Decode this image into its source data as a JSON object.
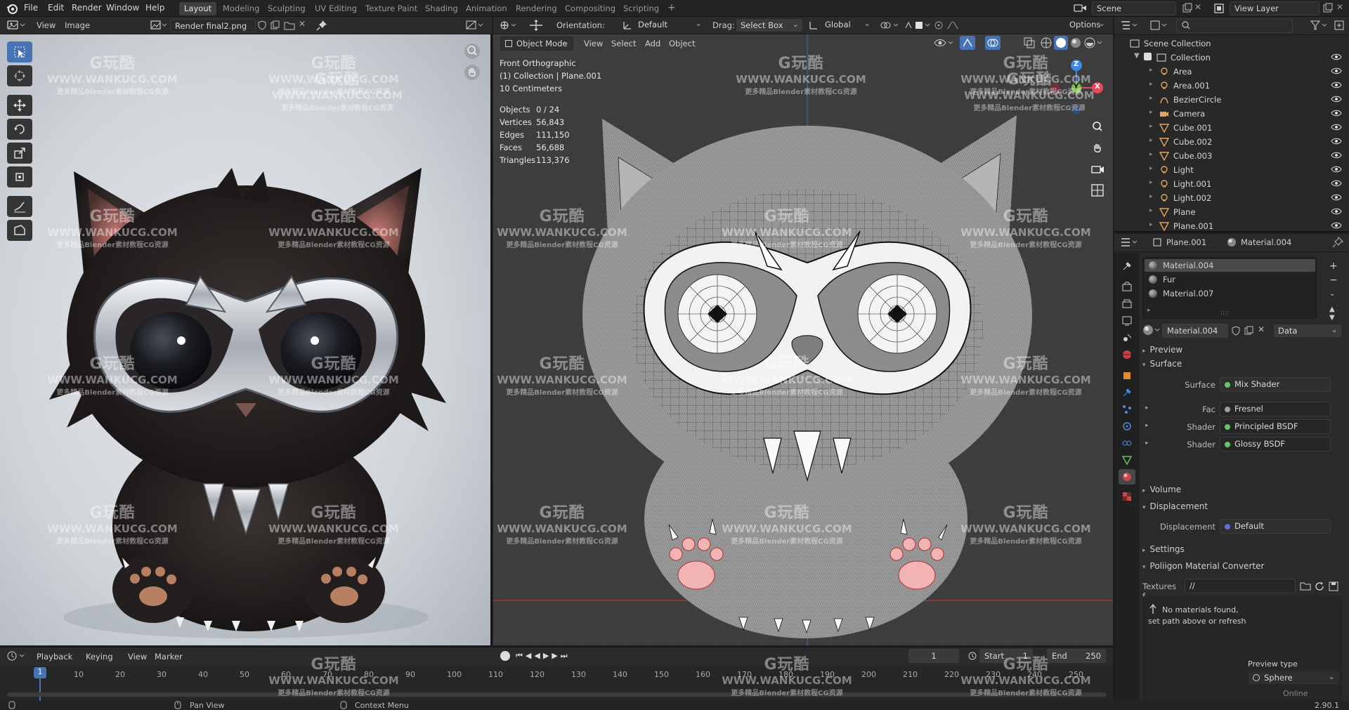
{
  "topbar": {
    "menus": [
      "File",
      "Edit",
      "Render",
      "Window",
      "Help"
    ],
    "workspaces": [
      "Layout",
      "Modeling",
      "Sculpting",
      "UV Editing",
      "Texture Paint",
      "Shading",
      "Animation",
      "Rendering",
      "Compositing",
      "Scripting"
    ],
    "active_workspace": "Layout",
    "add_tab": "+",
    "scene": "Scene",
    "view_layer": "View Layer"
  },
  "image_editor": {
    "menus": [
      "View",
      "Image"
    ],
    "image_name": "Render final2.png"
  },
  "viewport": {
    "orientation_label": "Orientation:",
    "orientation_value": "Default",
    "drag_label": "Drag:",
    "drag_value": "Select Box",
    "transform_space": "Global",
    "options": "Options",
    "mode": "Object Mode",
    "menus": [
      "View",
      "Select",
      "Add",
      "Object"
    ],
    "info": [
      "Front Orthographic",
      "(1) Collection | Plane.001",
      "10 Centimeters"
    ],
    "stats": [
      {
        "label": "Objects",
        "value": "0 / 24"
      },
      {
        "label": "Vertices",
        "value": "56,843"
      },
      {
        "label": "Edges",
        "value": "111,150"
      },
      {
        "label": "Faces",
        "value": "56,688"
      },
      {
        "label": "Triangles",
        "value": "113,376"
      }
    ],
    "gizmo": {
      "z": "Z",
      "y": "Y",
      "x": "X"
    }
  },
  "outliner": {
    "root": "Scene Collection",
    "collection": "Collection",
    "items": [
      "Area",
      "Area.001",
      "BezierCircle",
      "Camera",
      "Cube.001",
      "Cube.002",
      "Cube.003",
      "Light",
      "Light.001",
      "Light.002",
      "Plane",
      "Plane.001"
    ]
  },
  "properties": {
    "object_name": "Plane.001",
    "material_name": "Material.004",
    "slots": [
      "Material.004",
      "Fur",
      "Material.007"
    ],
    "selected_material": "Material.004",
    "data_link": "Data",
    "sections": {
      "preview": "Preview",
      "surface": "Surface",
      "volume": "Volume",
      "displacement": "Displacement",
      "settings": "Settings",
      "converter": "Poliigon Material Converter"
    },
    "surface_rows": [
      {
        "label": "Surface",
        "value": "Mix Shader"
      },
      {
        "label": "Fac",
        "value": "Fresnel"
      },
      {
        "label": "Shader",
        "value": "Principled BSDF"
      },
      {
        "label": "Shader",
        "value": "Glossy BSDF"
      }
    ],
    "displacement_label": "Displacement",
    "displacement_value": "Default",
    "textures_label": "Textures f...",
    "textures_value": "//",
    "no_materials_line1": "No materials found,",
    "no_materials_line2": "set path above or refresh",
    "preview_type_label": "Preview type",
    "preview_type_value": "Sphere",
    "online": "Online"
  },
  "timeline": {
    "menus": [
      "Playback",
      "Keying",
      "View",
      "Marker"
    ],
    "current_frame": "1",
    "start_label": "Start",
    "start_value": "1",
    "end_label": "End",
    "end_value": "250",
    "ticks": [
      "1",
      "10",
      "20",
      "30",
      "40",
      "50",
      "60",
      "70",
      "80",
      "90",
      "100",
      "110",
      "120",
      "130",
      "140",
      "150",
      "160",
      "170",
      "180",
      "190",
      "200",
      "210",
      "220",
      "230",
      "240",
      "250"
    ]
  },
  "statusbar": {
    "pan_view": "Pan View",
    "context_menu": "Context Menu",
    "version": "2.90.1"
  },
  "watermark": {
    "brand": "G玩酷",
    "url": "WWW.WANKUCG.COM",
    "tagline": "更多精品Blender素材教程CG资源"
  },
  "colors": {
    "accent_blue": "#4772b3",
    "active_material": "#4a4a4a",
    "node_green": "#63c763",
    "axis_x": "#e84a5a",
    "axis_y": "#7ec242",
    "axis_z": "#3b88e6"
  }
}
